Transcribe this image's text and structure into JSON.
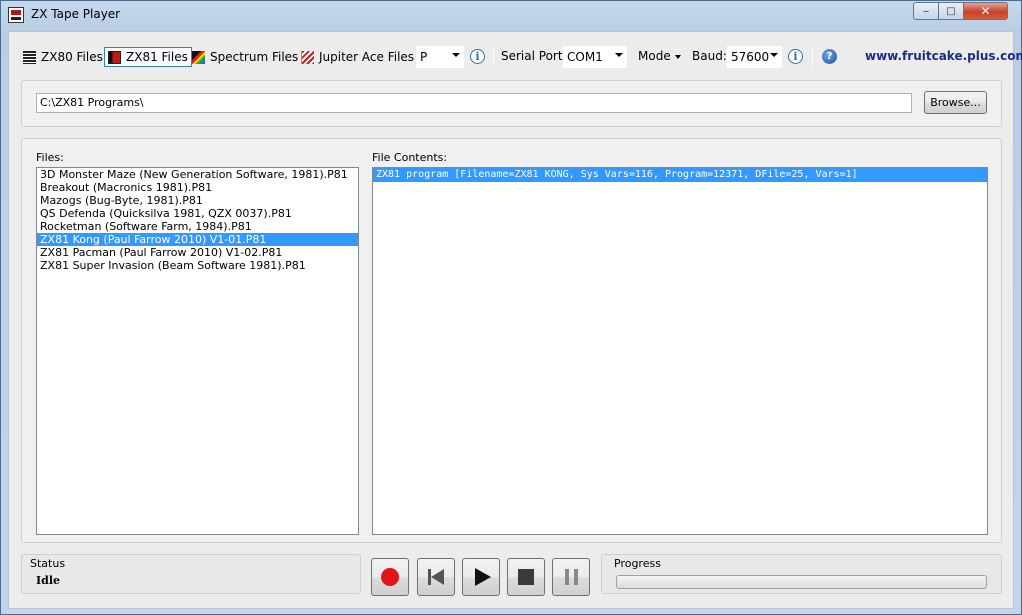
{
  "window": {
    "title": "ZX Tape Player",
    "close_glyph": "✕",
    "max_glyph": "□",
    "min_glyph": "‒"
  },
  "toolbar": {
    "zx80_label": "ZX80 Files",
    "zx81_label": "ZX81 Files",
    "spectrum_label": "Spectrum Files",
    "jupiter_label": "Jupiter Ace Files",
    "file_type_value": "P",
    "serial_port_label": "Serial Port:",
    "serial_port_value": "COM1",
    "mode_label": "Mode",
    "baud_label": "Baud:",
    "baud_value": "57600",
    "info_glyph": "i",
    "help_glyph": "?",
    "website": "www.fruitcake.plus.com"
  },
  "path": {
    "value": "C:\\ZX81 Programs\\",
    "browse_label": "Browse..."
  },
  "files": {
    "label": "Files:",
    "items": [
      "3D Monster Maze (New Generation Software, 1981).P81",
      "Breakout (Macronics 1981).P81",
      "Mazogs (Bug-Byte, 1981).P81",
      "QS Defenda (Quicksilva 1981, QZX 0037).P81",
      "Rocketman (Software Farm, 1984).P81",
      "ZX81 Kong (Paul Farrow 2010) V1-01.P81",
      "ZX81 Pacman (Paul Farrow 2010) V1-02.P81",
      "ZX81 Super Invasion (Beam Software 1981).P81"
    ],
    "selected_index": 5
  },
  "contents": {
    "label": "File Contents:",
    "items": [
      "ZX81 program [Filename=ZX81 KONG, Sys Vars=116, Program=12371, DFile=25, Vars=1]"
    ]
  },
  "status": {
    "label": "Status",
    "value": "Idle"
  },
  "progress": {
    "label": "Progress",
    "fraction": 0
  },
  "colors": {
    "selection": "#3399ff",
    "record": "#e0141a",
    "link": "#1a2b8c"
  }
}
